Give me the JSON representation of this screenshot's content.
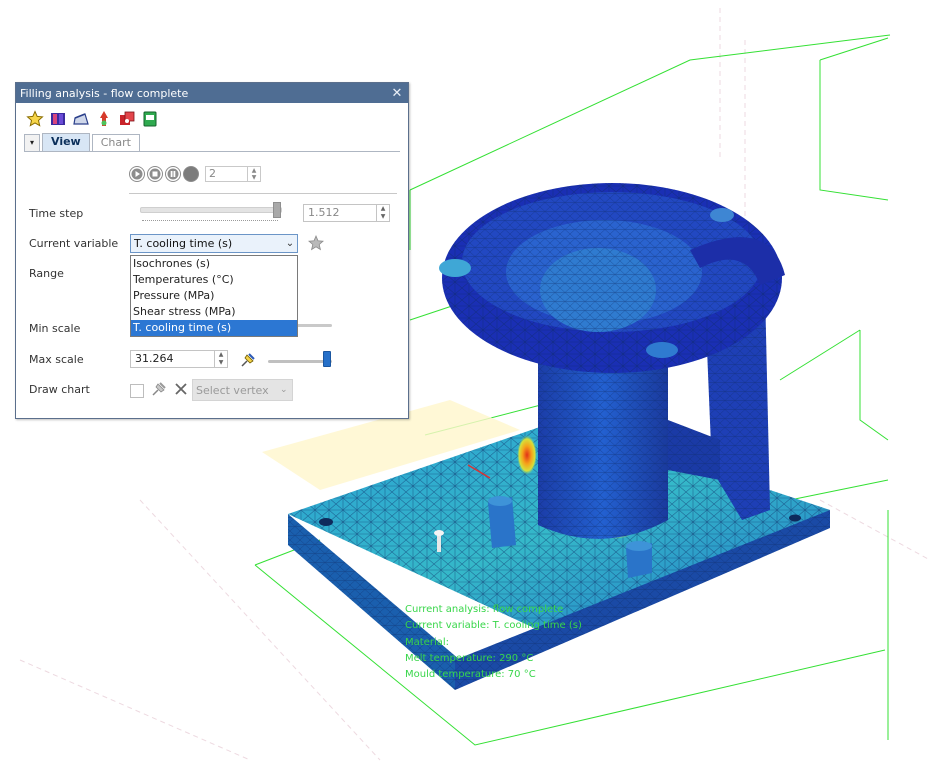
{
  "window": {
    "title": "Filling analysis - flow complete",
    "close_glyph": "✕"
  },
  "toolbar": {
    "icons": [
      "star-icon",
      "materials-icon",
      "flow-icon",
      "injection-point-icon",
      "mould-icon",
      "export-icon"
    ]
  },
  "tabs": {
    "collapse_glyph": "▾",
    "view": "View",
    "chart": "Chart"
  },
  "player": {
    "frame_value": "2"
  },
  "time_step": {
    "label": "Time step",
    "value": "1.512"
  },
  "current_variable": {
    "label": "Current variable",
    "selected": "T. cooling time (s)",
    "options": [
      "Isochrones (s)",
      "Temperatures (°C)",
      "Pressure (MPa)",
      "Shear stress (MPa)",
      "T. cooling time (s)"
    ]
  },
  "range": {
    "label": "Range"
  },
  "min_scale": {
    "label": "Min scale"
  },
  "max_scale": {
    "label": "Max scale",
    "value": "31.264"
  },
  "draw_chart": {
    "label": "Draw chart",
    "vertex_placeholder": "Select vertex"
  },
  "viewport": {
    "result_lines": [
      "Current analysis:  flow complete",
      "Current variable:  T. cooling time (s)",
      "Material:",
      "Melt temperature:   290 °C",
      "Mould temperature:   70 °C"
    ],
    "colors": {
      "mesh_high": "#1f3fd6",
      "mesh_mid": "#1f8fd0",
      "mesh_low": "#33c2c0",
      "hot": "#e5321b",
      "grid": "#34e034"
    }
  }
}
